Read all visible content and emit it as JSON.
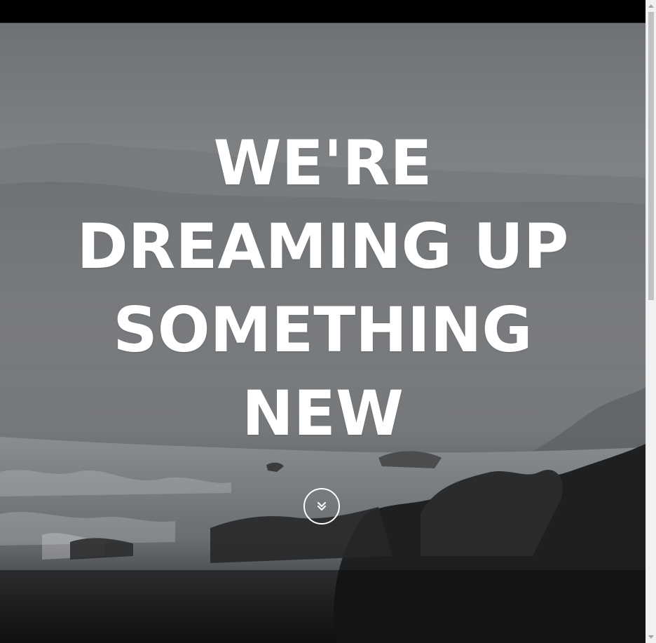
{
  "hero": {
    "headline_lines": [
      "WE'RE",
      "DREAMING UP",
      "SOMETHING",
      "NEW"
    ],
    "text_color": "#ffffff",
    "scroll_icon": "double-chevron-down-icon"
  },
  "scrollbar": {
    "up_icon": "scroll-up-arrow-icon",
    "down_icon": "scroll-down-arrow-icon"
  }
}
